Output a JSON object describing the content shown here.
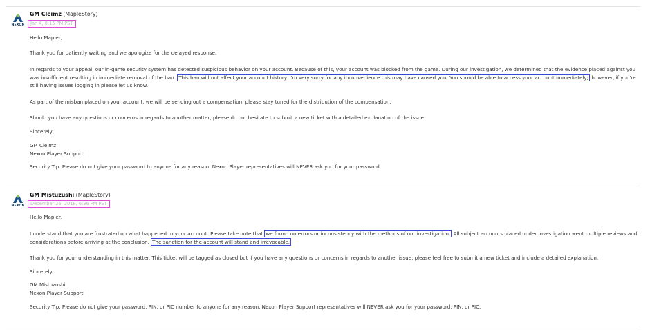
{
  "messages": [
    {
      "author": "GM Cleimz",
      "game": "(MapleStory)",
      "date": "Jan 4, 8:15 PM PST",
      "logo_text": "NEXON",
      "greeting": "Hello Mapler,",
      "p1": "Thank you for patiently waiting and we apologize for the delayed response.",
      "p2_line1": "In regards to your appeal, our in-game security system has detected suspicious behavior on your account. Because of this, your account was blocked from the game. During our investigation, we determined that the evidence placed against you",
      "p2_line2_pre": "was insufficient resulting in immediate removal of the ban.",
      "p2_line2_highlight": "This ban will not affect your account history. I'm very sorry for any inconvenience this may have caused you. You should be able to access your account immediately;",
      "p2_line2_post": "however, if you're",
      "p2_line3": "still having issues logging in please let us know.",
      "p3": "As part of the misban placed on your account, we will be sending out a compensation, please stay tuned for the distribution of the compensation.",
      "p4": "Should you have any questions or concerns in regards to another matter, please do not hesitate to submit a new ticket with a detailed explanation of the issue.",
      "sign_off": "Sincerely,",
      "sig_name": "GM Cleimz",
      "sig_team": "Nexon Player Support",
      "security_tip": "Security Tip: Please do not give your password to anyone for any reason. Nexon Player representatives will NEVER ask you for your password."
    },
    {
      "author": "GM Mistuzushi",
      "game": "(MapleStory)",
      "date": "December 26, 2018, 6:36 PM PST",
      "logo_text": "NEXON",
      "greeting": "Hello Mapler,",
      "p1_line1_pre": "I understand that you are frustrated on what happened to your account. Please take note that",
      "p1_line1_highlight": "we found no errors or inconsistency with the methods of our investigation.",
      "p1_line1_post": "All subject accounts placed under investigation went multiple reviews and",
      "p1_line2_pre": "considerations before arriving at the conclusion.",
      "p1_line2_highlight": "The sanction for the account will stand and irrevocable.",
      "p2": "Thank you for your understanding in this matter. This ticket will be tagged as closed but if you have any questions or concerns in regards to another issue, please feel free to submit a new ticket and include a detailed explanation.",
      "sign_off": "Sincerely,",
      "sig_name": "GM Mistuzushi",
      "sig_team": "Nexon Player Support",
      "security_tip": "Security Tip: Please do not give your password, PIN, or PIC number to anyone for any reason. Nexon Player Support representatives will NEVER ask you for your password, PIN, or PIC."
    }
  ]
}
